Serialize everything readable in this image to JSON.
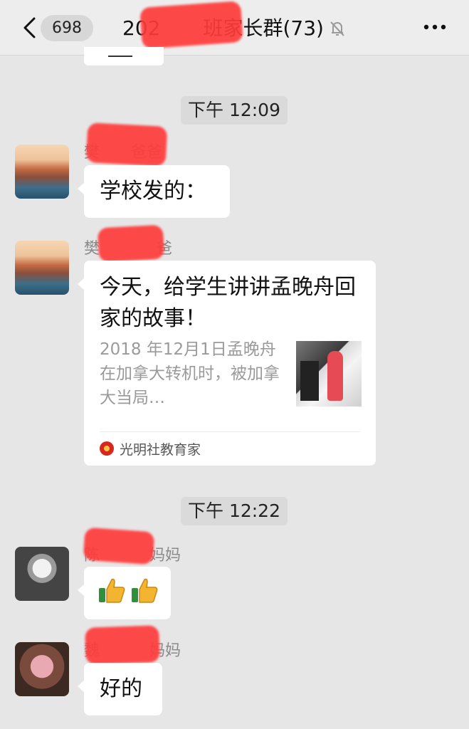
{
  "header": {
    "unread_count": "698",
    "title": "2023级3班家长群(73)",
    "title_visible_prefix": "202",
    "title_visible_suffix": "班家长群(73)",
    "back_icon": "chevron-left-icon",
    "mute_icon": "bell-off-icon",
    "more_icon": "more-dots-icon"
  },
  "timestamps": [
    "下午 12:09",
    "下午 12:22"
  ],
  "messages": [
    {
      "sender_visible": "樊",
      "sender_visible_suffix": "爸爸",
      "type": "text",
      "text": "学校发的："
    },
    {
      "sender_visible": "樊",
      "sender_visible_suffix": "爸",
      "type": "link_card",
      "card": {
        "title": "今天，给学生讲讲孟晚舟回家的故事！",
        "description": "2018 年12月1日孟晚舟在加拿大转机时，被加拿大当局…",
        "source": "光明社教育家"
      }
    },
    {
      "sender_visible": "陈",
      "sender_visible_suffix": "妈妈",
      "type": "emoji",
      "emoji": [
        "thumbs-up-icon",
        "thumbs-up-icon"
      ]
    },
    {
      "sender_visible": "魏",
      "sender_visible_suffix": "妈妈",
      "type": "text",
      "text": "好的"
    }
  ],
  "colors": {
    "background": "#e6e6e6",
    "bubble": "#ffffff",
    "header": "#ededed",
    "redaction": "#ff3b3b",
    "source_logo": "#d8281e"
  }
}
